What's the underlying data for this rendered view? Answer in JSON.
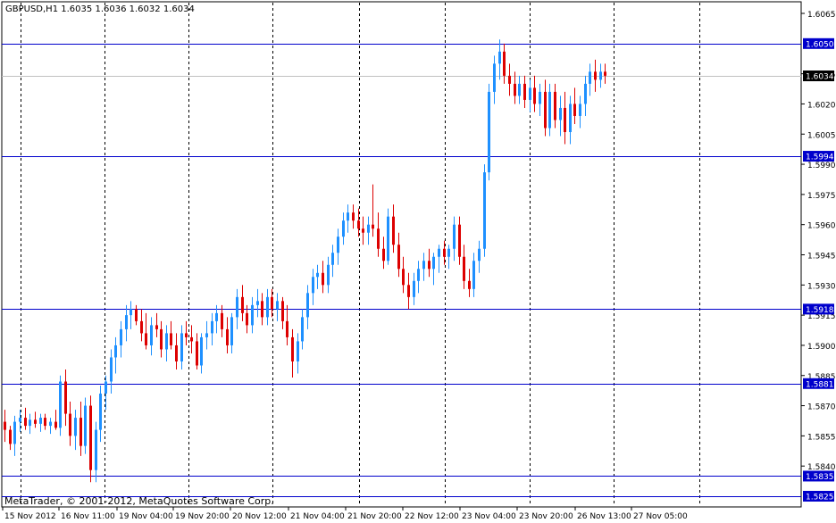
{
  "header": {
    "symbol": "GBPUSD,H1",
    "open": "1.6035",
    "high": "1.6036",
    "low": "1.6032",
    "close": "1.6034"
  },
  "copyright": "MetaTrader, © 2001-2012, MetaQuotes Software Corp.",
  "colors": {
    "background": "#ffffff",
    "bull": "#1e90ff",
    "bear": "#dd0000",
    "grid": "#000000",
    "hline": "#0000cc",
    "hline_label_bg": "#0000cc",
    "hline_label_text": "#ffffff",
    "price_line": "#c0c0c0",
    "current_price_bg": "#000000"
  },
  "chart_data": {
    "type": "candlestick",
    "y_ticks": [
      "1.6065",
      "1.6035",
      "1.6020",
      "1.6005",
      "1.5990",
      "1.5975",
      "1.5960",
      "1.5945",
      "1.5930",
      "1.5915",
      "1.5900",
      "1.5885",
      "1.5870",
      "1.5855",
      "1.5840"
    ],
    "x_labels": [
      "15 Nov 2012",
      "16 Nov 11:00",
      "19 Nov 04:00",
      "19 Nov 20:00",
      "20 Nov 12:00",
      "21 Nov 04:00",
      "21 Nov 20:00",
      "22 Nov 12:00",
      "23 Nov 04:00",
      "23 Nov 20:00",
      "26 Nov 13:00",
      "27 Nov 05:00"
    ],
    "horizontal_lines": [
      "1.6050",
      "1.5994",
      "1.5918",
      "1.5881",
      "1.5835",
      "1.5825"
    ],
    "current_price": "1.6034",
    "grid": "vertical dotted",
    "candles": [
      [
        1.5862,
        1.5868,
        1.5852,
        1.5858
      ],
      [
        1.5858,
        1.586,
        1.5848,
        1.5851
      ],
      [
        1.5851,
        1.5865,
        1.5845,
        1.5862
      ],
      [
        1.5862,
        1.5868,
        1.5857,
        1.5864
      ],
      [
        1.5864,
        1.5869,
        1.5858,
        1.586
      ],
      [
        1.586,
        1.5866,
        1.5856,
        1.5863
      ],
      [
        1.5863,
        1.5867,
        1.5859,
        1.5861
      ],
      [
        1.5861,
        1.5866,
        1.5857,
        1.5864
      ],
      [
        1.5864,
        1.5866,
        1.5858,
        1.586
      ],
      [
        1.586,
        1.5864,
        1.5856,
        1.5862
      ],
      [
        1.5862,
        1.5868,
        1.5858,
        1.5859
      ],
      [
        1.5859,
        1.5885,
        1.5855,
        1.5882
      ],
      [
        1.5882,
        1.5888,
        1.586,
        1.5866
      ],
      [
        1.5866,
        1.5872,
        1.585,
        1.5855
      ],
      [
        1.5855,
        1.5868,
        1.5848,
        1.5864
      ],
      [
        1.5864,
        1.5872,
        1.5845,
        1.585
      ],
      [
        1.585,
        1.5874,
        1.5846,
        1.587
      ],
      [
        1.587,
        1.5875,
        1.5832,
        1.5838
      ],
      [
        1.5838,
        1.5862,
        1.5832,
        1.5858
      ],
      [
        1.5858,
        1.588,
        1.5852,
        1.5876
      ],
      [
        1.5876,
        1.5885,
        1.5868,
        1.5882
      ],
      [
        1.5882,
        1.5898,
        1.5876,
        1.5894
      ],
      [
        1.5894,
        1.5904,
        1.5886,
        1.59
      ],
      [
        1.59,
        1.5912,
        1.5894,
        1.5908
      ],
      [
        1.5908,
        1.592,
        1.5902,
        1.5915
      ],
      [
        1.5915,
        1.5922,
        1.5908,
        1.5918
      ],
      [
        1.5918,
        1.592,
        1.591,
        1.5912
      ],
      [
        1.5912,
        1.5918,
        1.5902,
        1.5906
      ],
      [
        1.5906,
        1.5916,
        1.5898,
        1.59
      ],
      [
        1.59,
        1.5914,
        1.5895,
        1.591
      ],
      [
        1.591,
        1.5916,
        1.5904,
        1.5908
      ],
      [
        1.5908,
        1.5912,
        1.5894,
        1.5898
      ],
      [
        1.5898,
        1.591,
        1.5892,
        1.5906
      ],
      [
        1.5906,
        1.5912,
        1.5898,
        1.59
      ],
      [
        1.59,
        1.5906,
        1.5888,
        1.5892
      ],
      [
        1.5892,
        1.591,
        1.5888,
        1.5906
      ],
      [
        1.5906,
        1.5912,
        1.59,
        1.5904
      ],
      [
        1.5904,
        1.591,
        1.5896,
        1.5902
      ],
      [
        1.5902,
        1.5906,
        1.5888,
        1.589
      ],
      [
        1.589,
        1.5906,
        1.5886,
        1.5904
      ],
      [
        1.5904,
        1.5912,
        1.5898,
        1.5906
      ],
      [
        1.5906,
        1.5916,
        1.59,
        1.5912
      ],
      [
        1.5912,
        1.592,
        1.5906,
        1.5916
      ],
      [
        1.5916,
        1.592,
        1.5904,
        1.5908
      ],
      [
        1.5908,
        1.5914,
        1.5896,
        1.59
      ],
      [
        1.59,
        1.5916,
        1.5896,
        1.5914
      ],
      [
        1.5914,
        1.5928,
        1.5908,
        1.5924
      ],
      [
        1.5924,
        1.593,
        1.5912,
        1.5916
      ],
      [
        1.5916,
        1.592,
        1.5906,
        1.591
      ],
      [
        1.591,
        1.5924,
        1.5906,
        1.592
      ],
      [
        1.592,
        1.5928,
        1.5914,
        1.5922
      ],
      [
        1.5922,
        1.5926,
        1.591,
        1.5914
      ],
      [
        1.5914,
        1.5928,
        1.591,
        1.5924
      ],
      [
        1.5924,
        1.5928,
        1.5914,
        1.5918
      ],
      [
        1.5918,
        1.5926,
        1.5912,
        1.5922
      ],
      [
        1.5922,
        1.5924,
        1.5908,
        1.5912
      ],
      [
        1.5912,
        1.592,
        1.59,
        1.5904
      ],
      [
        1.5904,
        1.5908,
        1.5884,
        1.5892
      ],
      [
        1.5892,
        1.5906,
        1.5886,
        1.5902
      ],
      [
        1.5902,
        1.5918,
        1.5898,
        1.5914
      ],
      [
        1.5914,
        1.593,
        1.5908,
        1.5926
      ],
      [
        1.5926,
        1.5938,
        1.592,
        1.5934
      ],
      [
        1.5934,
        1.594,
        1.5928,
        1.5936
      ],
      [
        1.5936,
        1.5942,
        1.5926,
        1.593
      ],
      [
        1.593,
        1.5944,
        1.5926,
        1.594
      ],
      [
        1.594,
        1.595,
        1.5934,
        1.5946
      ],
      [
        1.5946,
        1.5958,
        1.594,
        1.5954
      ],
      [
        1.5954,
        1.5966,
        1.595,
        1.5962
      ],
      [
        1.5962,
        1.597,
        1.5956,
        1.5966
      ],
      [
        1.5966,
        1.597,
        1.5958,
        1.5962
      ],
      [
        1.5962,
        1.5968,
        1.5954,
        1.5958
      ],
      [
        1.5958,
        1.5964,
        1.595,
        1.5956
      ],
      [
        1.5956,
        1.5964,
        1.595,
        1.596
      ],
      [
        1.596,
        1.598,
        1.5954,
        1.5958
      ],
      [
        1.5958,
        1.5966,
        1.5944,
        1.5948
      ],
      [
        1.5948,
        1.5954,
        1.5938,
        1.5942
      ],
      [
        1.5942,
        1.5968,
        1.594,
        1.5964
      ],
      [
        1.5964,
        1.597,
        1.5946,
        1.595
      ],
      [
        1.595,
        1.5956,
        1.5934,
        1.5938
      ],
      [
        1.5938,
        1.5944,
        1.5926,
        1.593
      ],
      [
        1.593,
        1.5936,
        1.5918,
        1.5924
      ],
      [
        1.5924,
        1.5936,
        1.592,
        1.5932
      ],
      [
        1.5932,
        1.5942,
        1.5926,
        1.5938
      ],
      [
        1.5938,
        1.5946,
        1.5932,
        1.5942
      ],
      [
        1.5942,
        1.5948,
        1.5934,
        1.5938
      ],
      [
        1.5938,
        1.5946,
        1.593,
        1.5944
      ],
      [
        1.5944,
        1.595,
        1.5936,
        1.5948
      ],
      [
        1.5948,
        1.5952,
        1.594,
        1.5944
      ],
      [
        1.5944,
        1.595,
        1.5938,
        1.5948
      ],
      [
        1.5948,
        1.5964,
        1.5942,
        1.596
      ],
      [
        1.596,
        1.5964,
        1.594,
        1.5944
      ],
      [
        1.5944,
        1.595,
        1.5928,
        1.5932
      ],
      [
        1.5932,
        1.5938,
        1.5924,
        1.5928
      ],
      [
        1.5928,
        1.5946,
        1.5924,
        1.5942
      ],
      [
        1.5942,
        1.5952,
        1.5936,
        1.5948
      ],
      [
        1.5948,
        1.599,
        1.5944,
        1.5986
      ],
      [
        1.5986,
        1.603,
        1.5982,
        1.6026
      ],
      [
        1.6026,
        1.6044,
        1.602,
        1.604
      ],
      [
        1.604,
        1.6052,
        1.6032,
        1.6046
      ],
      [
        1.6046,
        1.605,
        1.603,
        1.6034
      ],
      [
        1.6034,
        1.604,
        1.6024,
        1.603
      ],
      [
        1.603,
        1.6036,
        1.602,
        1.6024
      ],
      [
        1.6024,
        1.6034,
        1.602,
        1.603
      ],
      [
        1.603,
        1.6034,
        1.6018,
        1.6022
      ],
      [
        1.6022,
        1.6032,
        1.6016,
        1.6028
      ],
      [
        1.6028,
        1.6034,
        1.6016,
        1.602
      ],
      [
        1.602,
        1.603,
        1.6014,
        1.6026
      ],
      [
        1.6026,
        1.6032,
        1.6004,
        1.6008
      ],
      [
        1.6008,
        1.603,
        1.6004,
        1.6026
      ],
      [
        1.6026,
        1.603,
        1.6008,
        1.6012
      ],
      [
        1.6012,
        1.6024,
        1.6004,
        1.6018
      ],
      [
        1.6018,
        1.6026,
        1.6,
        1.6006
      ],
      [
        1.6006,
        1.6024,
        1.6,
        1.602
      ],
      [
        1.602,
        1.6028,
        1.601,
        1.6014
      ],
      [
        1.6014,
        1.6024,
        1.6008,
        1.602
      ],
      [
        1.602,
        1.6034,
        1.6014,
        1.603
      ],
      [
        1.603,
        1.604,
        1.6024,
        1.6036
      ],
      [
        1.6036,
        1.6042,
        1.6026,
        1.6032
      ],
      [
        1.6032,
        1.604,
        1.6028,
        1.6036
      ],
      [
        1.6036,
        1.604,
        1.603,
        1.6034
      ]
    ]
  }
}
